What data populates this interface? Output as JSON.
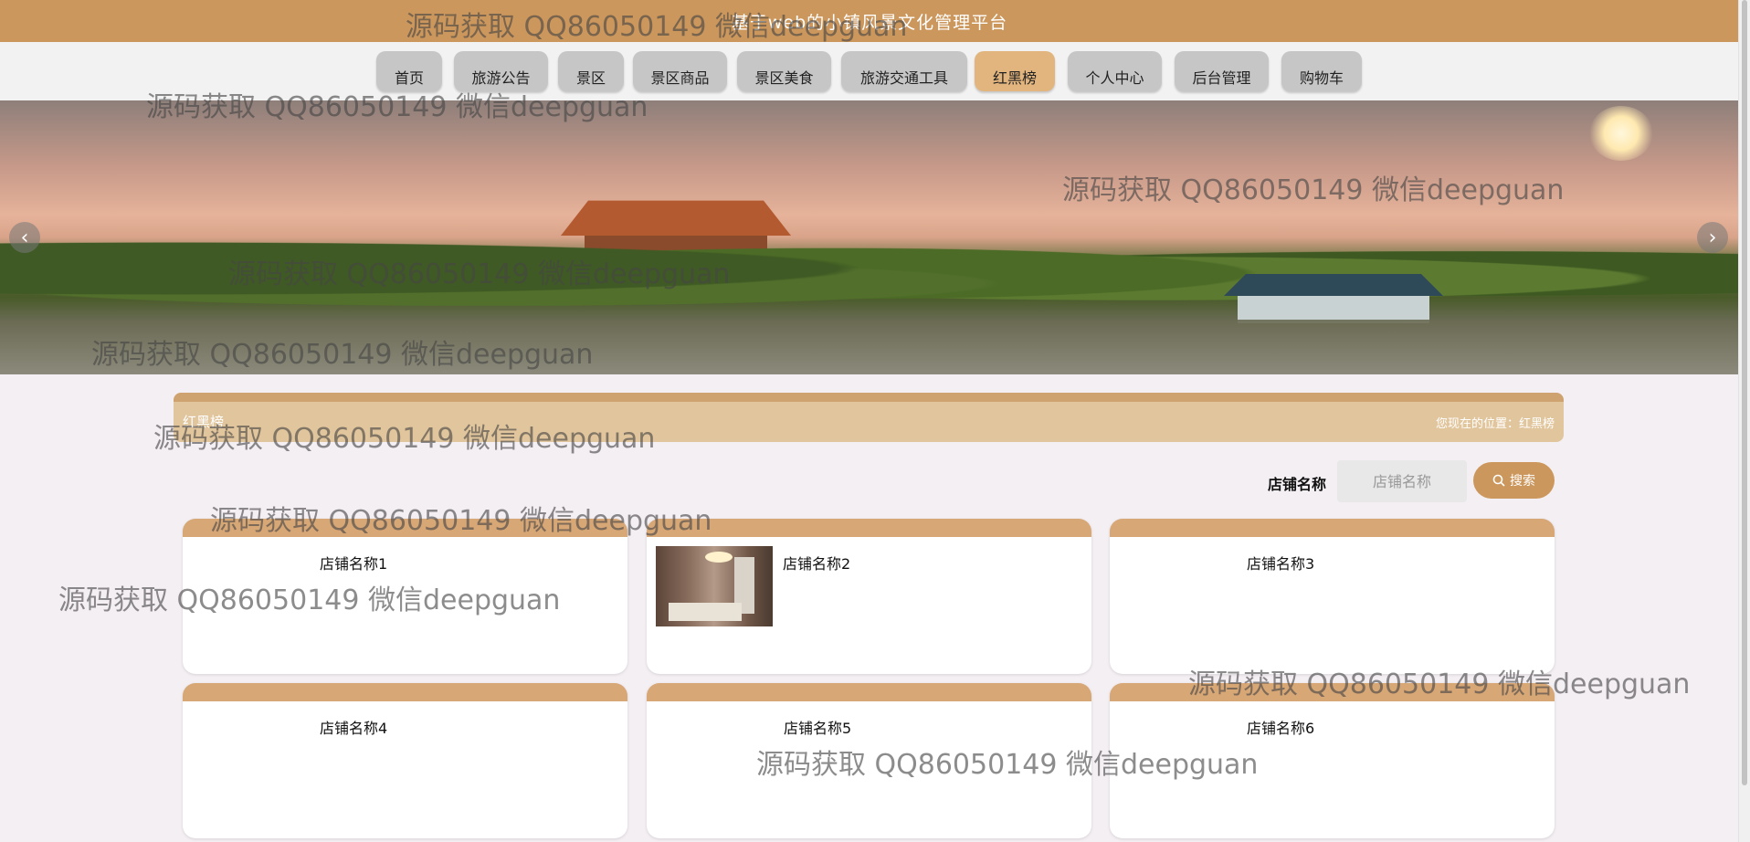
{
  "header": {
    "site_title": "基于web的小镇风景文化管理平台"
  },
  "nav": {
    "items": [
      {
        "label": "首页",
        "active": false
      },
      {
        "label": "旅游公告",
        "active": false
      },
      {
        "label": "景区",
        "active": false
      },
      {
        "label": "景区商品",
        "active": false
      },
      {
        "label": "景区美食",
        "active": false
      },
      {
        "label": "旅游交通工具",
        "active": false
      },
      {
        "label": "红黑榜",
        "active": true
      },
      {
        "label": "个人中心",
        "active": false
      },
      {
        "label": "后台管理",
        "active": false
      },
      {
        "label": "购物车",
        "active": false
      }
    ]
  },
  "carousel": {
    "prev_icon": "‹",
    "next_icon": "›"
  },
  "breadcrumb": {
    "title": "红黑榜",
    "position": "您现在的位置：红黑榜"
  },
  "search": {
    "label": "店铺名称",
    "placeholder": "店铺名称",
    "button_label": "搜索"
  },
  "shops": [
    {
      "name": "店铺名称1",
      "has_image": false
    },
    {
      "name": "店铺名称2",
      "has_image": true
    },
    {
      "name": "店铺名称3",
      "has_image": false
    },
    {
      "name": "店铺名称4",
      "has_image": false
    },
    {
      "name": "店铺名称5",
      "has_image": false
    },
    {
      "name": "店铺名称6",
      "has_image": false
    }
  ],
  "watermark_text": "源码获取 QQ86050149 微信deepguan",
  "colors": {
    "accent": "#cc975c",
    "active_tab": "#e2b57f",
    "card_top": "#d7a776",
    "crumb_bg": "#e1c59c"
  }
}
